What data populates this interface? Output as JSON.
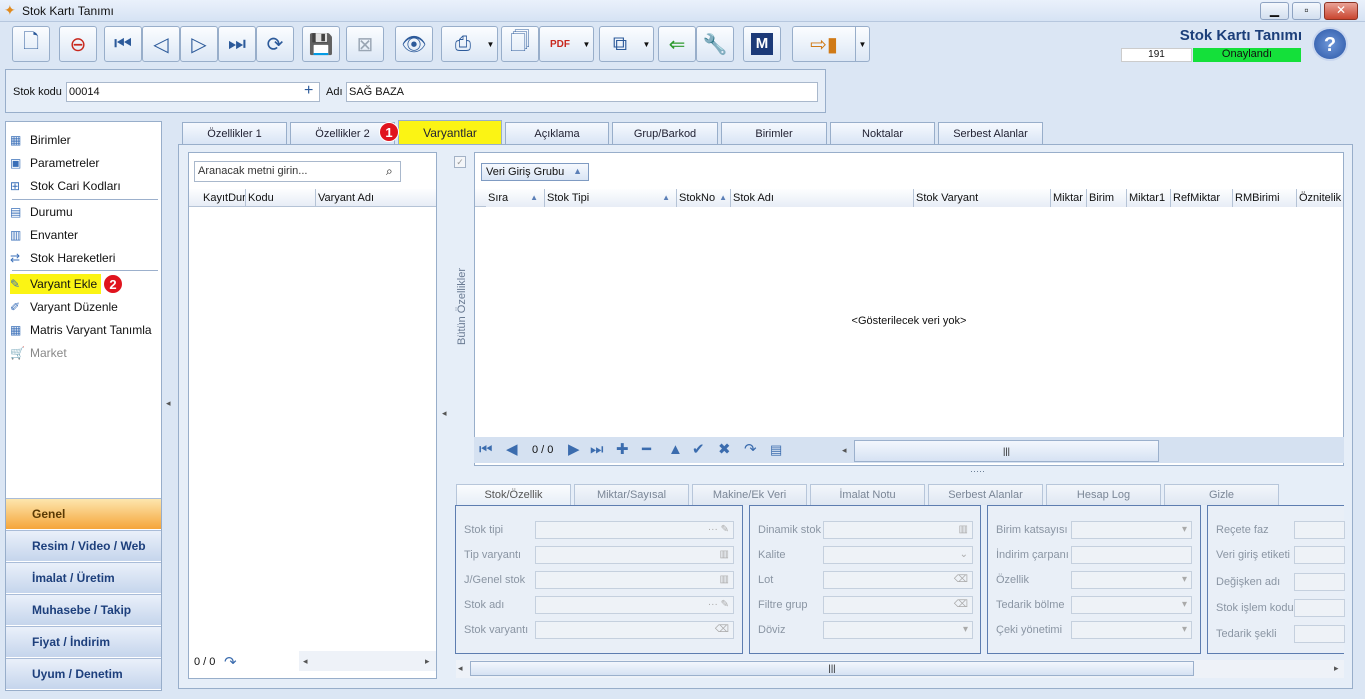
{
  "window": {
    "title": "Stok Kartı Tanımı"
  },
  "header": {
    "app_title": "Stok Kartı Tanımı",
    "record_no": "191",
    "status": "Onaylandı",
    "status_color": "#14e03a"
  },
  "toolbar": {
    "pdf_label": "PDF",
    "m_label": "M"
  },
  "form": {
    "stock_code_label": "Stok kodu",
    "stock_code_value": "00014",
    "name_label": "Adı",
    "name_value": "SAĞ BAZA"
  },
  "nav": {
    "items": [
      {
        "label": "Birimler",
        "icon": "units-icon"
      },
      {
        "label": "Parametreler",
        "icon": "parameters-icon"
      },
      {
        "label": "Stok Cari Kodları",
        "icon": "account-codes-icon"
      },
      {
        "label": "Durumu",
        "icon": "status-icon"
      },
      {
        "label": "Envanter",
        "icon": "inventory-icon"
      },
      {
        "label": "Stok Hareketleri",
        "icon": "movements-icon"
      },
      {
        "label": "Varyant Ekle",
        "icon": "add-variant-icon"
      },
      {
        "label": "Varyant Düzenle",
        "icon": "edit-variant-icon"
      },
      {
        "label": "Matris Varyant Tanımla",
        "icon": "matrix-icon"
      },
      {
        "label": "Market",
        "icon": "cart-icon"
      }
    ],
    "sections": [
      "Genel",
      "Resim / Video / Web",
      "İmalat / Üretim",
      "Muhasebe / Takip",
      "Fiyat / İndirim",
      "Uyum / Denetim"
    ],
    "badge1": "1",
    "badge2": "2",
    "highlight_color": "#fbf414"
  },
  "tabs": [
    "Özellikler 1",
    "Özellikler 2",
    "Varyantlar",
    "Açıklama",
    "Grup/Barkod",
    "Birimler",
    "Noktalar",
    "Serbest Alanlar"
  ],
  "list": {
    "search_placeholder": "Aranacak metni girin...",
    "columns": [
      "KayıtDur",
      "Kodu",
      "Varyant Adı"
    ],
    "counter": "0 / 0"
  },
  "grid": {
    "side_label": "Bütün Özellikler",
    "group_button": "Veri Giriş Grubu",
    "columns": [
      "Sıra",
      "Stok Tipi",
      "StokNo",
      "Stok Adı",
      "Stok Varyant",
      "Miktar",
      "Birim",
      "Miktar1",
      "RefMiktar",
      "RMBirimi",
      "Öznitelik"
    ],
    "empty_message": "<Gösterilecek veri yok>",
    "counter": "0 / 0"
  },
  "detail": {
    "tabs": [
      "Stok/Özellik",
      "Miktar/Sayısal",
      "Makine/Ek Veri",
      "İmalat Notu",
      "Serbest Alanlar",
      "Hesap Log",
      "Gizle"
    ],
    "col1": [
      "Stok tipi",
      "Tip varyantı",
      "J/Genel stok",
      "Stok adı",
      "Stok varyantı"
    ],
    "col2": [
      "Dinamik stok",
      "Kalite",
      "Lot",
      "Filtre grup",
      "Döviz"
    ],
    "col3": [
      "Birim katsayısı",
      "İndirim çarpanı",
      "Özellik",
      "Tedarik bölme",
      "Çeki yönetimi"
    ],
    "col4": [
      "Reçete faz",
      "Veri giriş etiketi",
      "Değişken adı",
      "Stok işlem kodu",
      "Tedarik şekli"
    ]
  }
}
